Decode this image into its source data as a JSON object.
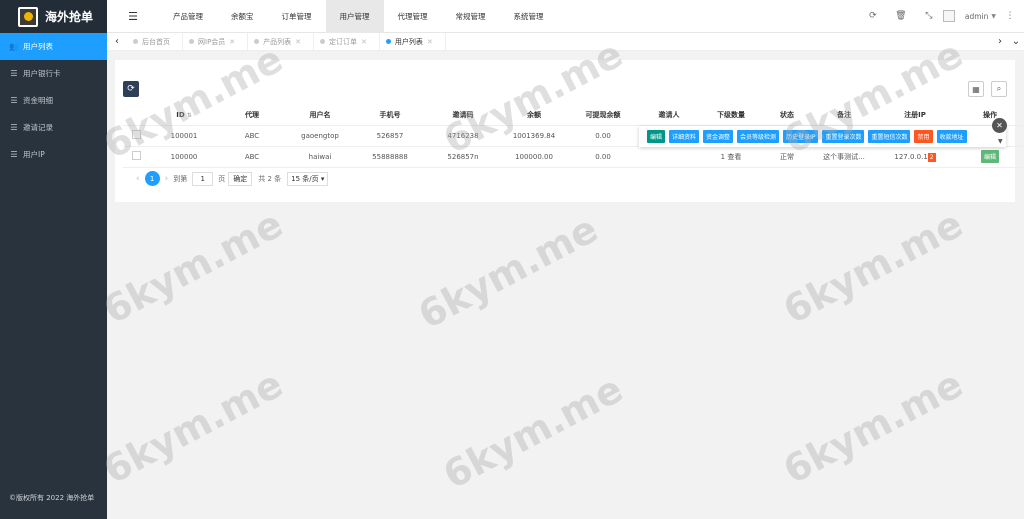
{
  "app": {
    "name": "海外抢单"
  },
  "sidebar": {
    "items": [
      {
        "label": "用户列表",
        "icon": "users-icon",
        "active": true
      },
      {
        "label": "用户银行卡",
        "icon": "list-icon",
        "active": false
      },
      {
        "label": "资金明细",
        "icon": "list-icon",
        "active": false
      },
      {
        "label": "邀请记录",
        "icon": "list-icon",
        "active": false
      },
      {
        "label": "用户IP",
        "icon": "list-icon",
        "active": false
      }
    ],
    "copyright": "©版权所有 2022 海外抢单"
  },
  "header": {
    "nav": [
      "产品管理",
      "余额宝",
      "订单管理",
      "用户管理",
      "代理管理",
      "常规管理",
      "系统管理"
    ],
    "active_nav": "用户管理",
    "user": "admin"
  },
  "tabs": {
    "items": [
      {
        "label": "后台首页",
        "closable": false
      },
      {
        "label": "网IP会员",
        "closable": true
      },
      {
        "label": "产品列表",
        "closable": true
      },
      {
        "label": "定订订单",
        "closable": true
      },
      {
        "label": "用户列表",
        "closable": true,
        "active": true
      }
    ]
  },
  "table": {
    "columns": [
      "ID",
      "代理",
      "用户名",
      "手机号",
      "邀请码",
      "余额",
      "可提现余额",
      "邀请人",
      "下级数量",
      "状态",
      "备注",
      "注册IP",
      "操作"
    ],
    "rows": [
      {
        "id": "100001",
        "agent": "ABC",
        "username": "gaoengtop",
        "phone": "526857",
        "invite_code": "4716238",
        "balance": "1001369.84",
        "withdrawable": "0.00",
        "inviter": "",
        "subordinates": "",
        "status": "",
        "remark": "",
        "ip": "",
        "ip_badge": ""
      },
      {
        "id": "100000",
        "agent": "ABC",
        "username": "haiwai",
        "phone": "55888888",
        "invite_code": "526857n",
        "balance": "100000.00",
        "withdrawable": "0.00",
        "inviter": "",
        "subordinates": "1 查看",
        "status": "正常",
        "remark": "这个事测试...",
        "ip": "127.0.0.1",
        "ip_badge": "2"
      }
    ],
    "row_edit_label": "编辑"
  },
  "op_popup": {
    "buttons": [
      {
        "label": "编辑",
        "color": "#009688"
      },
      {
        "label": "详细资料",
        "color": "#1e9fff"
      },
      {
        "label": "资金调整",
        "color": "#1e9fff"
      },
      {
        "label": "会员等级检测",
        "color": "#1e9fff"
      },
      {
        "label": "历史登录IP",
        "color": "#1e9fff"
      },
      {
        "label": "重置登录次数",
        "color": "#1e9fff"
      },
      {
        "label": "重置短信次数",
        "color": "#1e9fff"
      },
      {
        "label": "禁用",
        "color": "#ff5722"
      },
      {
        "label": "收款地址",
        "color": "#1e9fff"
      }
    ]
  },
  "pager": {
    "current": "1",
    "goto_label": "到第",
    "page_input": "1",
    "page_unit": "页",
    "confirm": "确定",
    "total": "共 2 条",
    "page_size": "15 条/页"
  },
  "watermark": {
    "text": "6kym.me"
  },
  "colors": {
    "primary": "#1e9fff",
    "sidebar": "#28333e",
    "danger": "#ff5722",
    "teal": "#009688"
  }
}
